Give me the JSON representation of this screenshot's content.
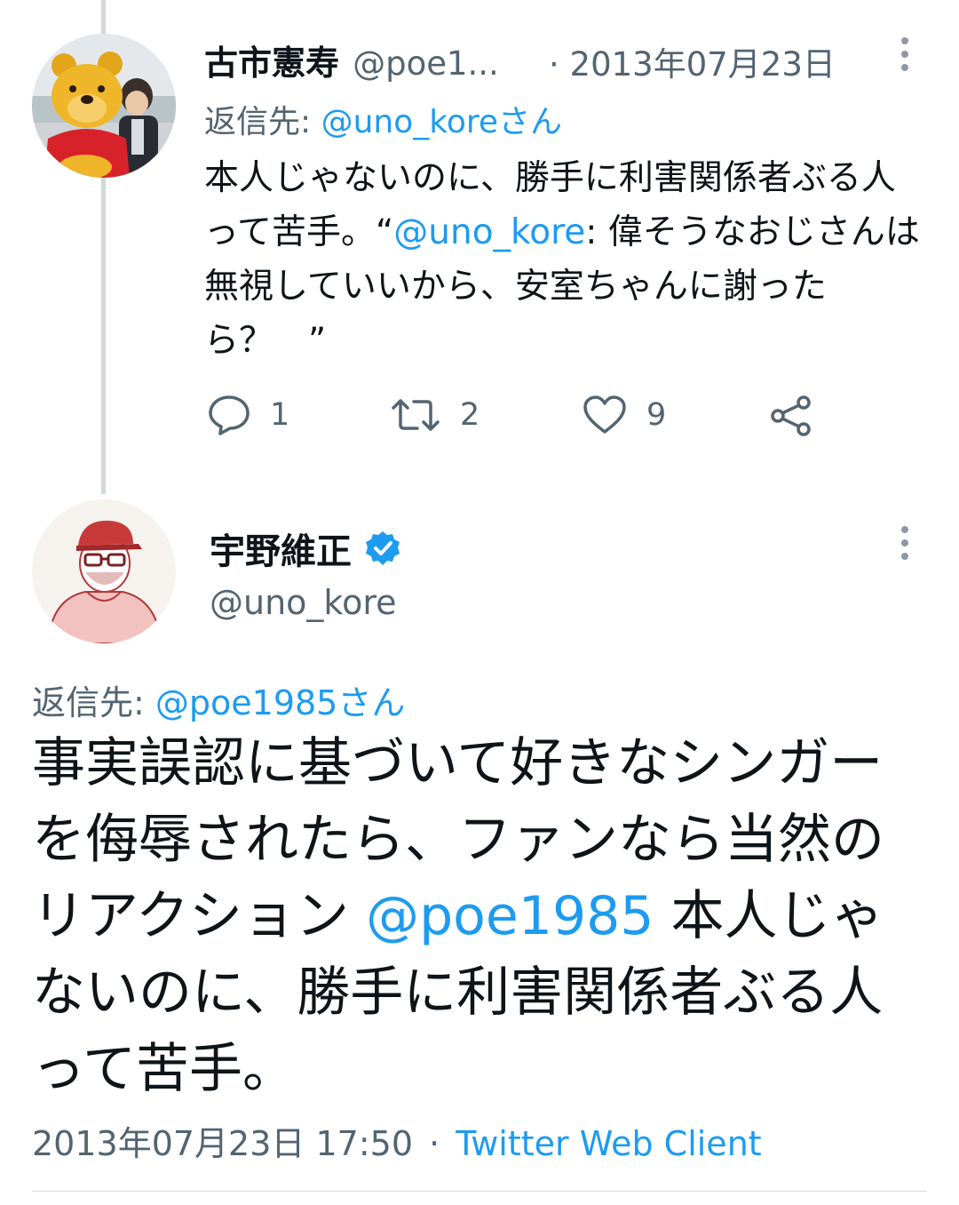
{
  "tweet1": {
    "author_name": "古市憲寿",
    "handle": "@poe1...",
    "date_sep": "·",
    "date": "2013年07月23日",
    "reply_prefix": "返信先:",
    "reply_to": "@uno_koreさん",
    "text_a": "本人じゃないのに、勝手に利害関係者ぶる人って苦手。“",
    "mention": "@uno_kore",
    "text_b": ": 偉そうなおじさんは無視していいから、安室ちゃんに謝ったら？　”",
    "replies": "1",
    "retweets": "2",
    "likes": "9"
  },
  "tweet2": {
    "author_name": "宇野維正",
    "handle": "@uno_kore",
    "reply_prefix": "返信先:",
    "reply_to": "@poe1985さん",
    "text_a": "事実誤認に基づいて好きなシンガーを侮辱されたら、ファンなら当然のリアクション ",
    "mention": "@poe1985",
    "text_b": " 本人じゃないのに、勝手に利害関係者ぶる人って苦手。",
    "timestamp": "2013年07月23日 17:50",
    "dot": "·",
    "client": "Twitter Web Client"
  },
  "colors": {
    "accent": "#1d9bf0",
    "secondary_text": "#536471",
    "primary_text": "#0f1419",
    "thread_line": "#cfd9de"
  },
  "icons": [
    "more-vertical-icon",
    "reply-icon",
    "retweet-icon",
    "like-icon",
    "share-icon",
    "verified-badge-icon"
  ]
}
